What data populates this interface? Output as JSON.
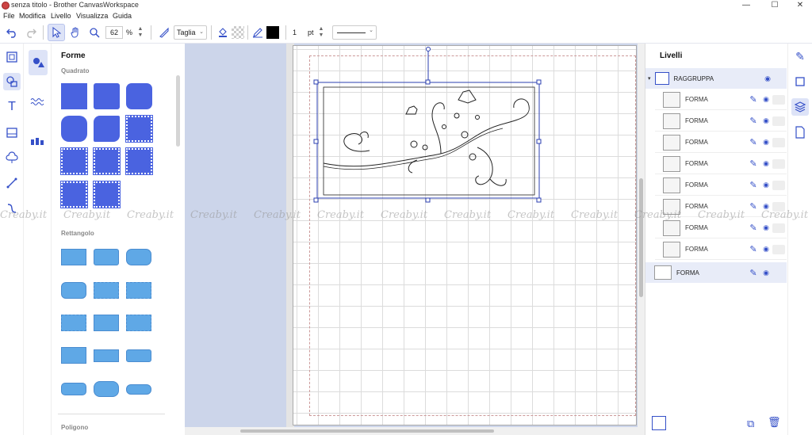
{
  "window": {
    "title": "senza titolo - Brother CanvasWorkspace",
    "minimize": "—",
    "maximize": "☐",
    "close": "✕"
  },
  "menu": [
    "File",
    "Modifica",
    "Livello",
    "Visualizza",
    "Guida"
  ],
  "toolbar": {
    "zoom_value": "62",
    "zoom_unit": "%",
    "operation": "Taglia",
    "line_width": "1",
    "line_unit": "pt"
  },
  "shapes_panel": {
    "title": "Forme",
    "sections": [
      "Quadrato",
      "Rettangolo",
      "Poligono"
    ]
  },
  "layers_panel": {
    "title": "Livelli",
    "group_label": "RAGGRUPPA",
    "items": [
      "FORMA",
      "FORMA",
      "FORMA",
      "FORMA",
      "FORMA",
      "FORMA",
      "FORMA",
      "FORMA"
    ],
    "bottom_item": "FORMA"
  },
  "watermark": "Creaby.it",
  "colors": {
    "accent": "#3550c8",
    "square_fill": "#4a63e0",
    "rect_fill": "#5fa8e6",
    "canvas_bg": "#ccd5ea",
    "selection": "#2b3fb0"
  }
}
